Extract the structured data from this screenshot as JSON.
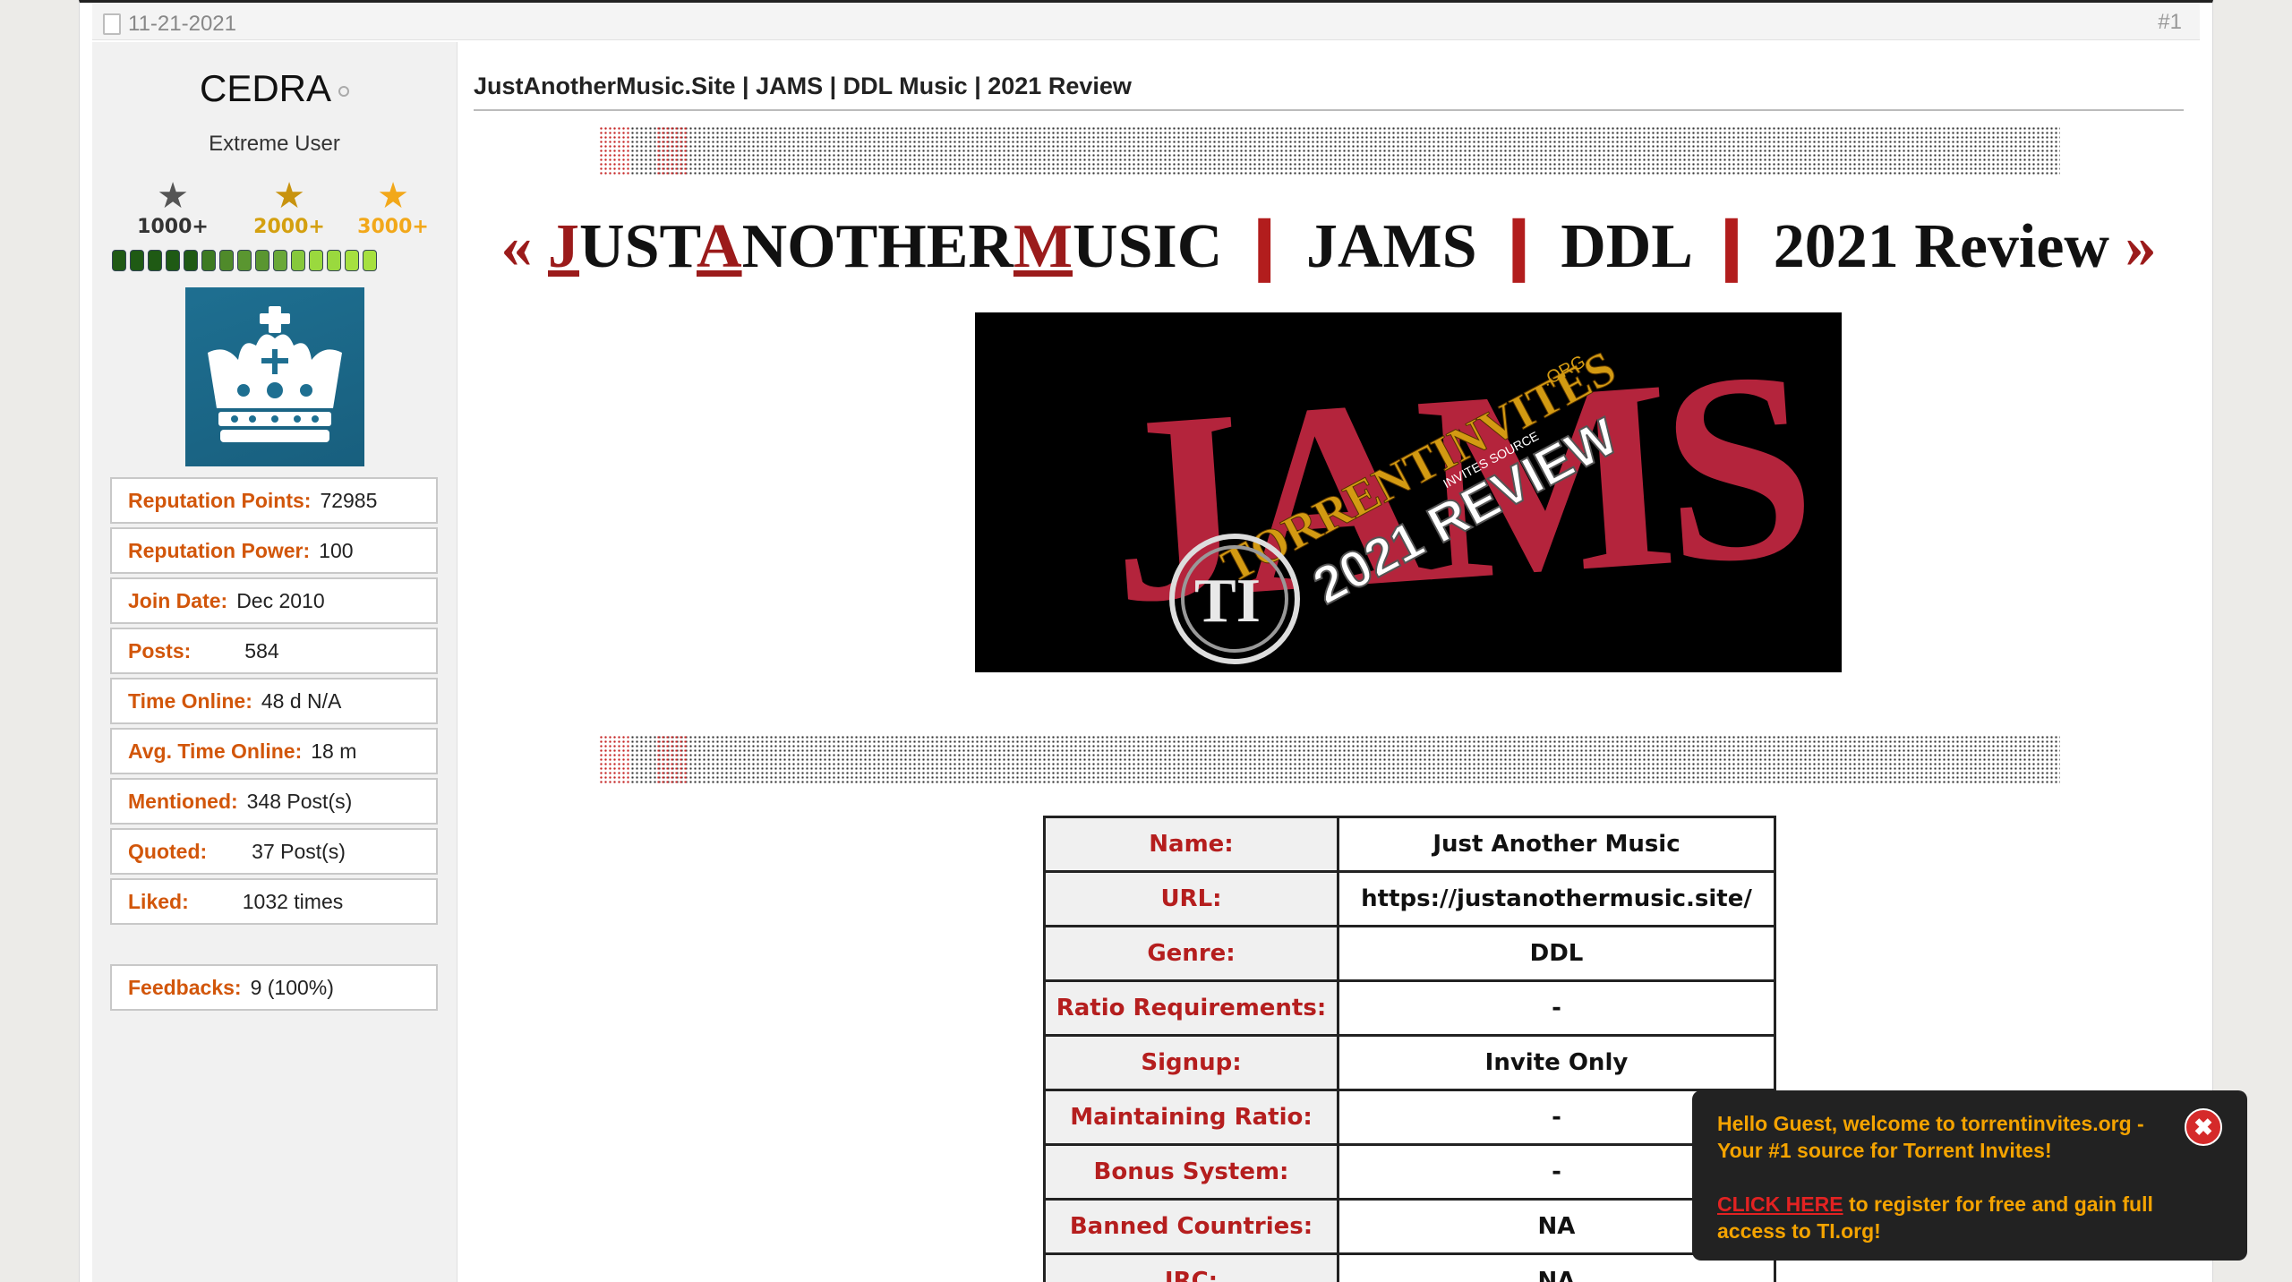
{
  "post": {
    "date": "11-21-2021",
    "number": "#1",
    "title": "JustAnotherMusic.Site | JAMS | DDL Music | 2021 Review"
  },
  "user": {
    "name": "CEDRA",
    "title": "Extreme User",
    "stars": [
      {
        "label": "1000+",
        "color": "#333333"
      },
      {
        "label": "2000+",
        "color": "#d4a010"
      },
      {
        "label": "3000+",
        "color": "#f2a81a"
      }
    ],
    "repbar_colors": [
      "#1f5a14",
      "#1f5a14",
      "#1f5a14",
      "#1f5a14",
      "#1f5a14",
      "#3d7a22",
      "#4f8a2a",
      "#5a9630",
      "#5a9630",
      "#6aa838",
      "#86c83c",
      "#9ad93e",
      "#9ad93e",
      "#a6e03f",
      "#a6e03f"
    ],
    "stats": [
      {
        "label": "Reputation Points:",
        "value": "72985"
      },
      {
        "label": "Reputation Power:",
        "value": "100"
      },
      {
        "label": "Join Date:",
        "value": "Dec 2010"
      },
      {
        "label": "Posts:",
        "value": "584"
      },
      {
        "label": "Time Online:",
        "value": "48 d N/A"
      },
      {
        "label": "Avg. Time Online:",
        "value": "18 m"
      },
      {
        "label": "Mentioned:",
        "value": "348 Post(s)"
      },
      {
        "label": "Quoted:",
        "value": "37 Post(s)"
      },
      {
        "label": "Liked:",
        "value": "1032 times"
      }
    ],
    "feedback": {
      "label": "Feedbacks:",
      "value": "9 (100%)"
    }
  },
  "headline": {
    "open": "«",
    "close": "»",
    "j": "J",
    "ust": "UST",
    "a": "A",
    "nother": "NOTHER",
    "m": "M",
    "usic": "USIC",
    "sep": "❙",
    "p2": "JAMS",
    "p3": "DDL",
    "p4": "2021 Review"
  },
  "banner": {
    "logo": "JAMS",
    "badge": "TI",
    "arc_text": "TORRENTINVITES",
    "org": ".ORG",
    "sub": "INVITES SOURCE",
    "review": "2021 REVIEW"
  },
  "table": [
    {
      "label": "Name:",
      "value": "Just Another Music"
    },
    {
      "label": "URL:",
      "value": "https://justanothermusic.site/"
    },
    {
      "label": "Genre:",
      "value": "DDL"
    },
    {
      "label": "Ratio Requirements:",
      "value": "-"
    },
    {
      "label": "Signup:",
      "value": "Invite Only"
    },
    {
      "label": "Maintaining Ratio:",
      "value": "-"
    },
    {
      "label": "Bonus System:",
      "value": "-"
    },
    {
      "label": "Banned Countries:",
      "value": "NA"
    },
    {
      "label": "IRC:",
      "value": "NA"
    }
  ],
  "popup": {
    "line1": "Hello Guest, welcome to torrentinvites.org - Your #1 source for Torrent Invites!",
    "link": "CLICK HERE",
    "line2": " to register for free and gain full access to TI.org!",
    "close": "✖"
  }
}
